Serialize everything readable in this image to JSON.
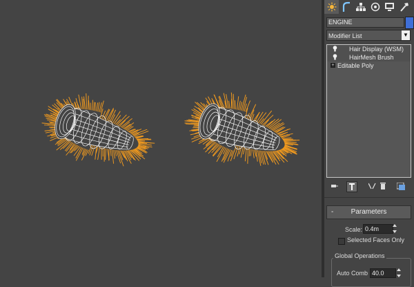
{
  "viewport": {
    "objects": [
      "left-engine-hair-mesh",
      "right-engine-hair-mesh"
    ],
    "hair_color": "#f39b1e",
    "wire_color": "#ffffff"
  },
  "command_panel": {
    "tabs": [
      {
        "name": "create-tab",
        "icon": "sun-icon"
      },
      {
        "name": "modify-tab",
        "icon": "bend-icon"
      },
      {
        "name": "hierarchy-tab",
        "icon": "hierarchy-icon"
      },
      {
        "name": "motion-tab",
        "icon": "motion-icon"
      },
      {
        "name": "display-tab",
        "icon": "monitor-icon"
      },
      {
        "name": "utilities-tab",
        "icon": "hammer-icon"
      }
    ],
    "object_name": "ENGINE",
    "object_color": "#3f6fd8",
    "modifier_list_label": "Modifier List",
    "stack": [
      {
        "label": "Hair Display (WSM)",
        "type": "modifier",
        "icon": "lightbulb-icon"
      },
      {
        "label": "HairMesh Brush",
        "type": "modifier",
        "icon": "lightbulb-icon"
      },
      {
        "label": "Editable Poly",
        "type": "base",
        "icon": "expand-icon"
      }
    ]
  },
  "parameters": {
    "rollout_title": "Parameters",
    "rollout_toggle": "-",
    "scale_label": "Scale:",
    "scale_value": "0.4m",
    "selected_faces_label": "Selected Faces Only",
    "selected_faces_checked": false,
    "global_ops_title": "Global Operations",
    "auto_comb_label": "Auto Comb",
    "auto_comb_value": "40.0"
  }
}
